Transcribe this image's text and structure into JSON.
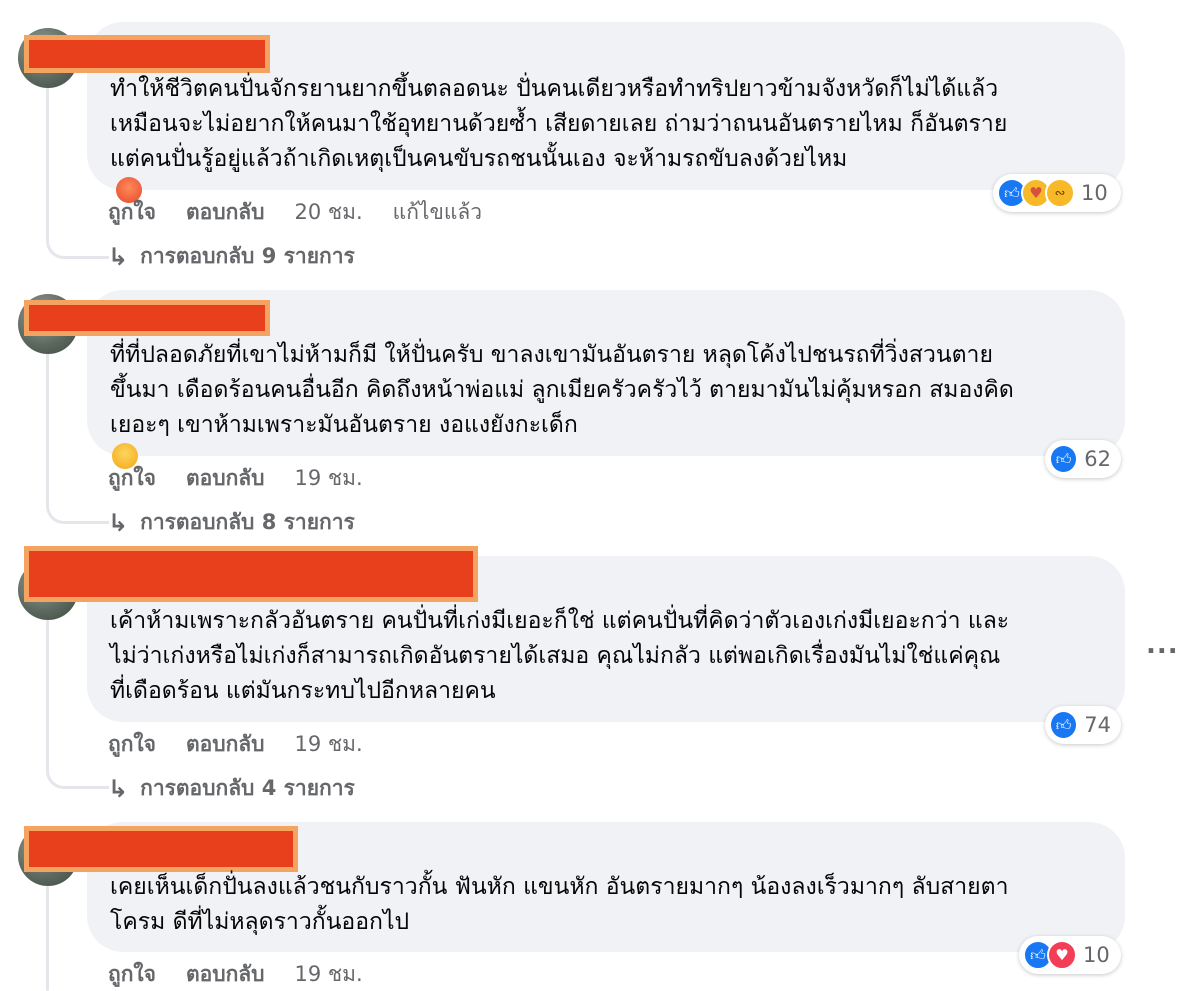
{
  "comments": [
    {
      "lines": [
        "ทำให้ชีวิตคนปั่นจักรยานยากขึ้นตลอดนะ ปั่นคนเดียวหรือทำทริปยาวข้ามจังหวัดก็ไม่ได้แล้ว",
        "เหมือนจะไม่อยากให้คนมาใช้อุทยานด้วยซ้ำ เสียดายเลย ถ่ามว่าถนนอันตรายไหม ก็อันตราย",
        "แต่คนปั่นรู้อยู่แล้วถ้าเกิดเหตุเป็นคนขับรถชนนั้นเอง จะห้ามรถขับลงด้วยไหม"
      ],
      "trailing_emoji": "angry-face",
      "reactions": [
        "like",
        "care",
        "haha"
      ],
      "reaction_count": "10",
      "like_label": "ถูกใจ",
      "reply_label": "ตอบกลับ",
      "time": "20 ชม.",
      "edited": "แก้ไขแล้ว",
      "replies_label": "การตอบกลับ 9 รายการ"
    },
    {
      "lines": [
        "ที่ที่ปลอดภัยที่เขาไม่ห้ามก็มี ให้ปั่นครับ ขาลงเขามันอันตราย หลุดโค้งไปชนรถที่วิ่งสวนตาย",
        "ขึ้นมา เดือดร้อนคนอื่นอีก คิดถึงหน้าพ่อแม่ ลูกเมียครัวครัวไว้ ตายมามันไม่คุ้มหรอก สมองคิด",
        "เยอะๆ เขาห้ามเพราะมันอันตราย งอแงยังกะเด็ก"
      ],
      "trailing_emoji": "rolling-laughing-face",
      "reactions": [
        "like"
      ],
      "reaction_count": "62",
      "like_label": "ถูกใจ",
      "reply_label": "ตอบกลับ",
      "time": "19 ชม.",
      "replies_label": "การตอบกลับ 8 รายการ"
    },
    {
      "lines": [
        "เค้าห้ามเพราะกลัวอันตราย คนปั่นที่เก่งมีเยอะก็ใช่ แต่คนปั่นที่คิดว่าตัวเองเก่งมีเยอะกว่า และ",
        "ไม่ว่าเก่งหรือไม่เก่งก็สามารถเกิดอันตรายได้เสมอ คุณไม่กลัว แต่พอเกิดเรื่องมันไม่ใช่แค่คุณ",
        "ที่เดือดร้อน แต่มันกระทบไปอีกหลายคน"
      ],
      "reactions": [
        "like"
      ],
      "reaction_count": "74",
      "like_label": "ถูกใจ",
      "reply_label": "ตอบกลับ",
      "time": "19 ชม.",
      "replies_label": "การตอบกลับ 4 รายการ"
    },
    {
      "lines": [
        "เคยเห็นเด็กปั่นลงแล้วชนกับราวกั้น ฟันหัก แขนหัก อันตรายมากๆ น้องลงเร็วมากๆ ลับสายตา",
        "โครม ดีที่ไม่หลุดราวกั้นออกไป"
      ],
      "reactions": [
        "like",
        "love"
      ],
      "reaction_count": "10",
      "like_label": "ถูกใจ",
      "reply_label": "ตอบกลับ",
      "time": "19 ชม."
    }
  ],
  "more_options": "...",
  "colors": {
    "bubble": "#f0f2f5",
    "secondary_text": "#65676b",
    "like_blue": "#1877f2",
    "redaction": "#e8401c"
  }
}
